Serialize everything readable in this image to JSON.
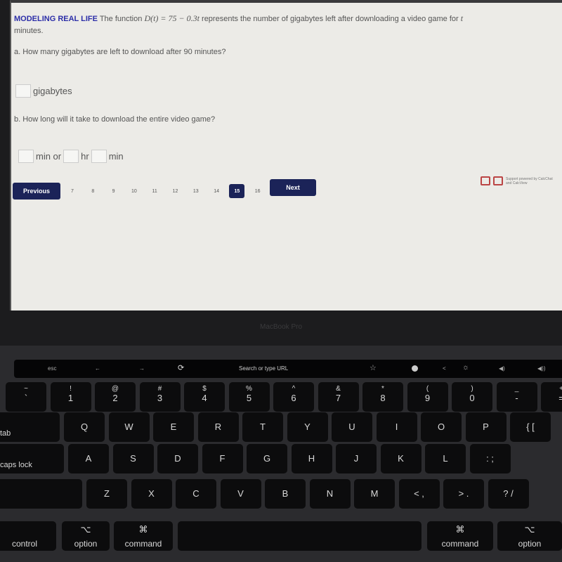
{
  "problem": {
    "label": "MODELING REAL LIFE",
    "text_before": "The function",
    "formula": "D(t) = 75 − 0.3t",
    "text_after": "represents the number of gigabytes left after downloading a video game for",
    "var": "t",
    "text_end": "minutes.",
    "part_a": "a. How many gigabytes are left to download after 90 minutes?",
    "unit_a": "gigabytes",
    "part_b": "b. How long will it take to download the entire video game?",
    "unit_b1": "min or",
    "unit_b2": "hr",
    "unit_b3": "min"
  },
  "pagination": {
    "previous": "Previous",
    "next": "Next",
    "pages": [
      "7",
      "8",
      "9",
      "10",
      "11",
      "12",
      "13",
      "14",
      "15",
      "16"
    ],
    "active": "15"
  },
  "support": "Support powered by CalcChat and CalcView",
  "laptop": {
    "brand": "MacBook Pro"
  },
  "touchbar": {
    "esc": "esc",
    "back": "←",
    "forward": "→",
    "reload": "⟳",
    "search": "Search or type URL",
    "bookmark": "☆",
    "brightness": "☼",
    "volume_down": "◀)",
    "volume_up": "◀))"
  },
  "keys": {
    "row1": [
      [
        "~",
        "`"
      ],
      [
        "!",
        "1"
      ],
      [
        "@",
        "2"
      ],
      [
        "#",
        "3"
      ],
      [
        "$",
        "4"
      ],
      [
        "%",
        "5"
      ],
      [
        "^",
        "6"
      ],
      [
        "&",
        "7"
      ],
      [
        "*",
        "8"
      ],
      [
        "(",
        "9"
      ],
      [
        ")",
        "0"
      ],
      [
        "_",
        "-"
      ],
      [
        "+",
        "="
      ]
    ],
    "row2": [
      "tab",
      "Q",
      "W",
      "E",
      "R",
      "T",
      "Y",
      "U",
      "I",
      "O",
      "P",
      "{ ["
    ],
    "row3": [
      "caps lock",
      "A",
      "S",
      "D",
      "F",
      "G",
      "H",
      "J",
      "K",
      "L",
      ": ;"
    ],
    "row4": [
      "",
      "Z",
      "X",
      "C",
      "V",
      "B",
      "N",
      "M",
      "< ,",
      "> .",
      "? /"
    ],
    "row5": [
      [
        "",
        "control"
      ],
      [
        "⌥",
        "option"
      ],
      [
        "⌘",
        "command"
      ],
      [
        "",
        ""
      ],
      [
        "⌘",
        "command"
      ],
      [
        "⌥",
        "option"
      ]
    ]
  }
}
